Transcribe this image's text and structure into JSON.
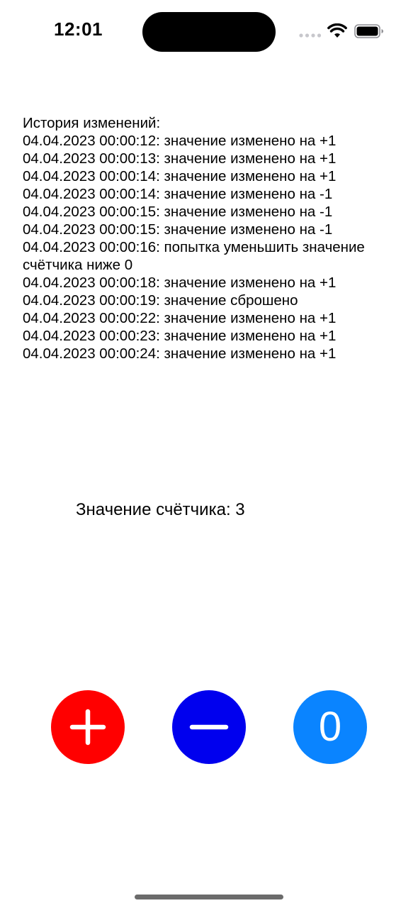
{
  "status_bar": {
    "time": "12:01"
  },
  "history": {
    "title": "История изменений:",
    "entries": [
      "04.04.2023 00:00:12: значение изменено на +1",
      "04.04.2023 00:00:13: значение изменено на +1",
      "04.04.2023 00:00:14: значение изменено на +1",
      "04.04.2023 00:00:14: значение изменено на -1",
      "04.04.2023 00:00:15: значение изменено на -1",
      "04.04.2023 00:00:15: значение изменено на -1",
      "04.04.2023 00:00:16: попытка уменьшить значение счётчика ниже 0",
      "04.04.2023 00:00:18: значение изменено на +1",
      "04.04.2023 00:00:19: значение сброшено",
      "04.04.2023 00:00:22: значение изменено на +1",
      "04.04.2023 00:00:23: значение изменено на +1",
      "04.04.2023 00:00:24: значение изменено на +1"
    ]
  },
  "counter": {
    "label": "Значение счётчика: 3"
  },
  "buttons": {
    "increment": {
      "icon": "plus-icon",
      "color": "#ff0000"
    },
    "decrement": {
      "icon": "minus-icon",
      "color": "#0000ee"
    },
    "reset": {
      "label": "0",
      "color": "#0a84ff"
    }
  }
}
